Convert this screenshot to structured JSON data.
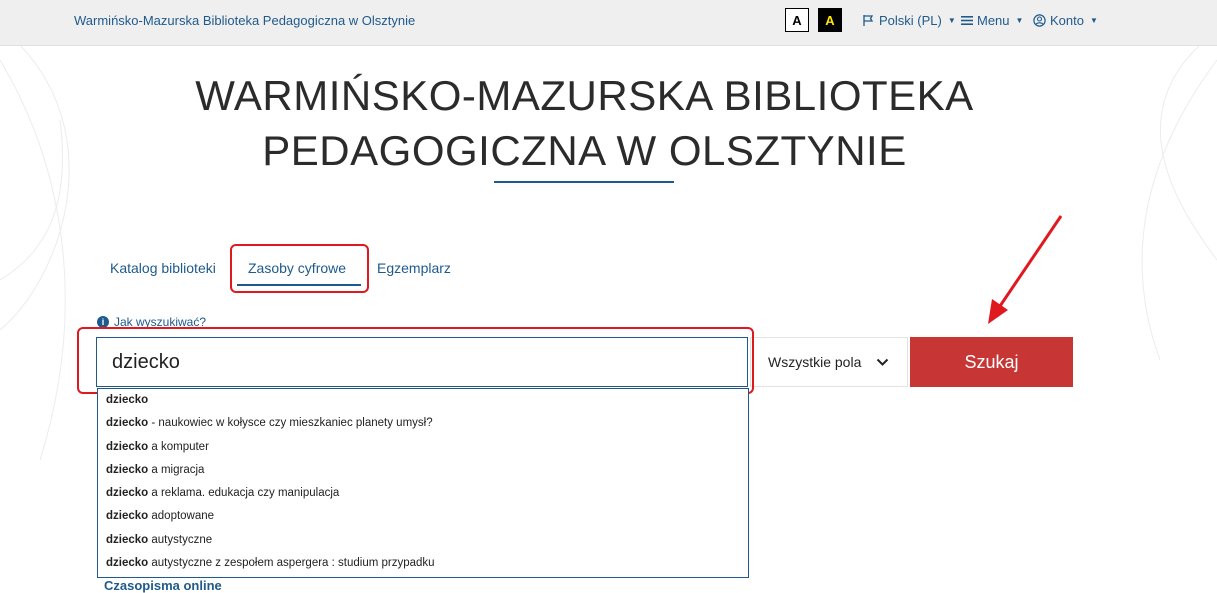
{
  "topbar": {
    "site_name": "Warmińsko-Mazurska Biblioteka Pedagogiczna w Olsztynie",
    "contrast_normal": "A",
    "contrast_high": "A",
    "language": "Polski (PL)",
    "menu": "Menu",
    "account": "Konto"
  },
  "heading": {
    "line1": "WARMIŃSKO-MAZURSKA BIBLIOTEKA",
    "line2": "PEDAGOGICZNA W OLSZTYNIE"
  },
  "tabs": [
    {
      "label": "Katalog biblioteki"
    },
    {
      "label": "Zasoby cyfrowe"
    },
    {
      "label": "Egzemplarz"
    }
  ],
  "search": {
    "help_link": "Jak wyszukiwać?",
    "query": "dziecko",
    "field_selected": "Wszystkie pola",
    "button_label": "Szukaj"
  },
  "suggestions": [
    {
      "bold": "dziecko",
      "rest": ""
    },
    {
      "bold": "dziecko",
      "rest": " - naukowiec w kołysce czy mieszkaniec planety umysł?"
    },
    {
      "bold": "dziecko",
      "rest": " a komputer"
    },
    {
      "bold": "dziecko",
      "rest": " a migracja"
    },
    {
      "bold": "dziecko",
      "rest": " a reklama. edukacja czy manipulacja"
    },
    {
      "bold": "dziecko",
      "rest": " adoptowane"
    },
    {
      "bold": "dziecko",
      "rest": " autystyczne"
    },
    {
      "bold": "dziecko",
      "rest": " autystyczne z zespołem aspergera : studium przypadku"
    }
  ],
  "below": {
    "partial_link": "Czasopisma online"
  },
  "colors": {
    "brand_blue": "#1f5a8c",
    "search_button": "#c73535",
    "annotation_red": "#e0191f"
  }
}
